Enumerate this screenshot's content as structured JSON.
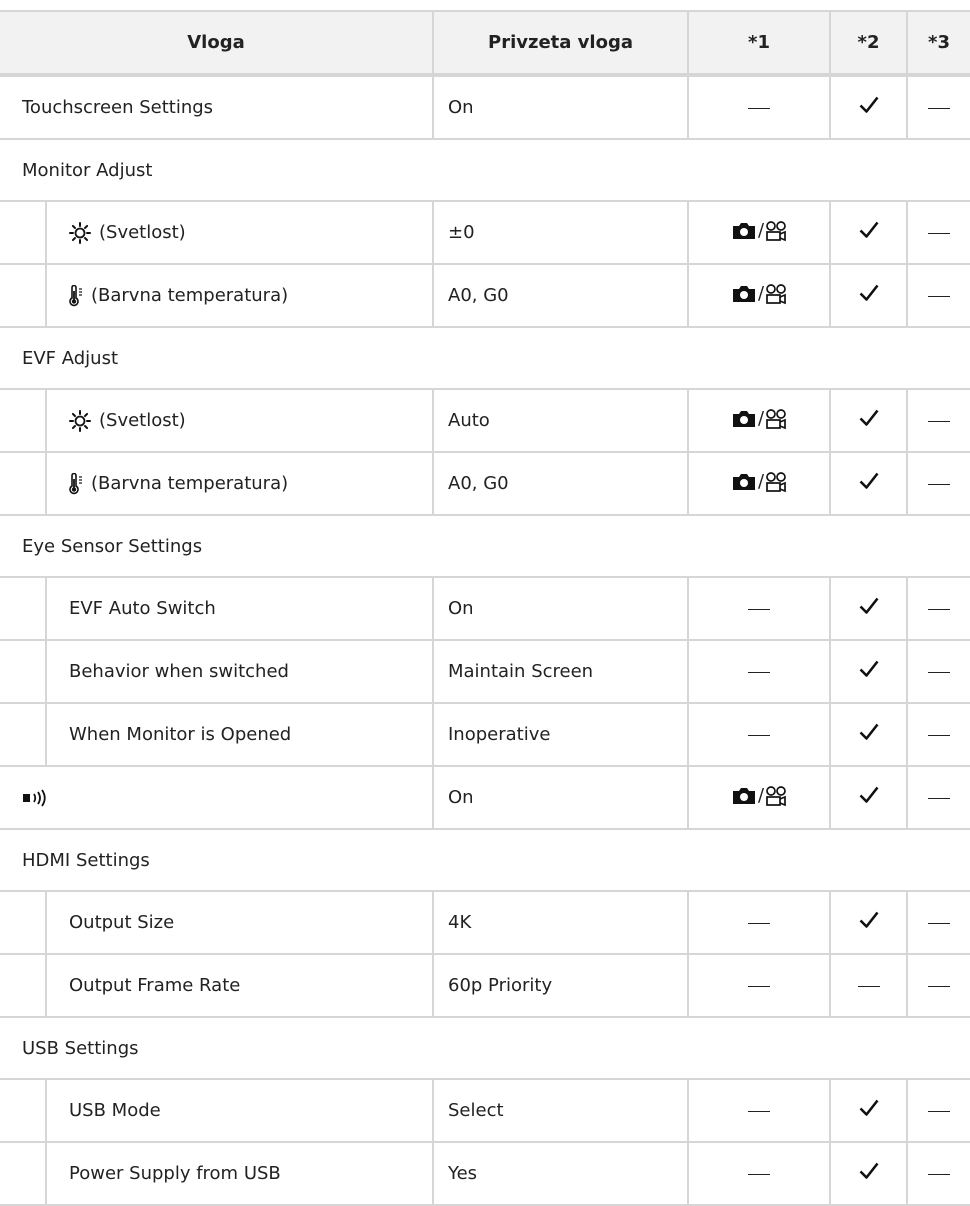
{
  "headers": {
    "name": "Vloga",
    "default": "Privzeta vloga",
    "s1": "*1",
    "s2": "*2",
    "s3": "*3"
  },
  "rows": [
    {
      "type": "row",
      "icon": "",
      "label": "Touchscreen Settings",
      "value": "On",
      "s1": "dash",
      "s2": "check",
      "s3": "dash"
    },
    {
      "type": "group",
      "label": "Monitor Adjust"
    },
    {
      "type": "subrow",
      "icon": "brightness-icon",
      "label": "(Svetlost)",
      "value": "±0",
      "s1": "camera-movie",
      "s2": "check",
      "s3": "dash"
    },
    {
      "type": "subrow",
      "icon": "thermometer-icon",
      "label": "(Barvna temperatura)",
      "value": "A0, G0",
      "s1": "camera-movie",
      "s2": "check",
      "s3": "dash"
    },
    {
      "type": "group",
      "label": "EVF Adjust"
    },
    {
      "type": "subrow",
      "icon": "brightness-icon",
      "label": "(Svetlost)",
      "value": "Auto",
      "s1": "camera-movie",
      "s2": "check",
      "s3": "dash"
    },
    {
      "type": "subrow",
      "icon": "thermometer-icon",
      "label": "(Barvna temperatura)",
      "value": "A0, G0",
      "s1": "camera-movie",
      "s2": "check",
      "s3": "dash"
    },
    {
      "type": "group",
      "label": "Eye Sensor Settings"
    },
    {
      "type": "subrow",
      "icon": "",
      "label": "EVF Auto Switch",
      "value": "On",
      "s1": "dash",
      "s2": "check",
      "s3": "dash"
    },
    {
      "type": "subrow",
      "icon": "",
      "label": "Behavior when switched",
      "value": "Maintain Screen",
      "s1": "dash",
      "s2": "check",
      "s3": "dash"
    },
    {
      "type": "subrow",
      "icon": "",
      "label": "When Monitor is Opened",
      "value": "Inoperative",
      "s1": "dash",
      "s2": "check",
      "s3": "dash"
    },
    {
      "type": "row",
      "icon": "sound-icon",
      "label": "",
      "value": "On",
      "s1": "camera-movie",
      "s2": "check",
      "s3": "dash"
    },
    {
      "type": "group",
      "label": "HDMI Settings"
    },
    {
      "type": "subrow",
      "icon": "",
      "label": "Output Size",
      "value": "4K",
      "s1": "dash",
      "s2": "check",
      "s3": "dash"
    },
    {
      "type": "subrow",
      "icon": "",
      "label": "Output Frame Rate",
      "value": "60p Priority",
      "s1": "dash",
      "s2": "dash",
      "s3": "dash"
    },
    {
      "type": "group",
      "label": "USB Settings"
    },
    {
      "type": "subrow",
      "icon": "",
      "label": "USB Mode",
      "value": "Select",
      "s1": "dash",
      "s2": "check",
      "s3": "dash"
    },
    {
      "type": "subrow",
      "icon": "",
      "label": "Power Supply from USB",
      "value": "Yes",
      "s1": "dash",
      "s2": "check",
      "s3": "dash"
    }
  ]
}
